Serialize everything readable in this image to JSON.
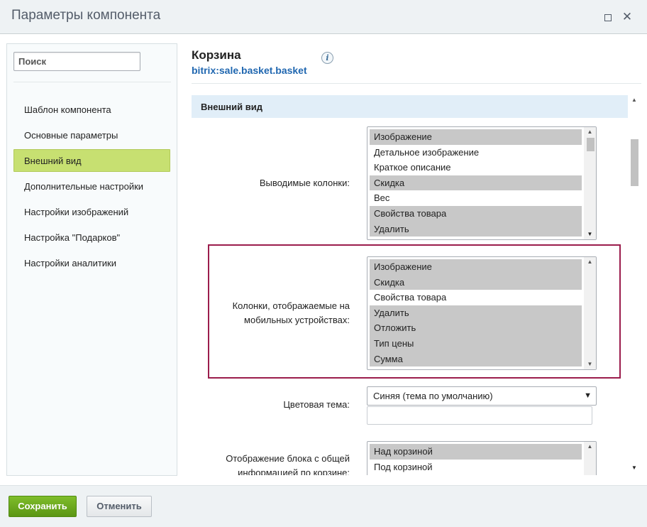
{
  "window": {
    "title": "Параметры компонента"
  },
  "sidebar": {
    "search_placeholder": "Поиск",
    "items": [
      {
        "label": "Шаблон компонента"
      },
      {
        "label": "Основные параметры"
      },
      {
        "label": "Внешний вид"
      },
      {
        "label": "Дополнительные настройки"
      },
      {
        "label": "Настройки изображений"
      },
      {
        "label": "Настройка \"Подарков\""
      },
      {
        "label": "Настройки аналитики"
      }
    ],
    "active_index": 2
  },
  "component": {
    "name": "Корзина",
    "code": "bitrix:sale.basket.basket"
  },
  "section": {
    "title": "Внешний вид"
  },
  "fields": {
    "columns": {
      "label": "Выводимые колонки:",
      "options": [
        {
          "text": "Изображение",
          "selected": true
        },
        {
          "text": "Детальное изображение",
          "selected": false
        },
        {
          "text": "Краткое описание",
          "selected": false
        },
        {
          "text": "Скидка",
          "selected": true
        },
        {
          "text": "Вес",
          "selected": false
        },
        {
          "text": "Свойства товара",
          "selected": true
        },
        {
          "text": "Удалить",
          "selected": true
        }
      ]
    },
    "mobile_columns": {
      "label": "Колонки, отображаемые на мобильных устройствах:",
      "options": [
        {
          "text": "Изображение",
          "selected": true
        },
        {
          "text": "Скидка",
          "selected": true
        },
        {
          "text": "Свойства товара",
          "selected": false
        },
        {
          "text": "Удалить",
          "selected": true
        },
        {
          "text": "Отложить",
          "selected": true
        },
        {
          "text": "Тип цены",
          "selected": true
        },
        {
          "text": "Сумма",
          "selected": true
        }
      ]
    },
    "color_theme": {
      "label": "Цветовая тема:",
      "value": "Синяя (тема по умолчанию)"
    },
    "total_block": {
      "label": "Отображение блока с общей информацией по корзине:",
      "options": [
        {
          "text": "Над корзиной",
          "selected": true
        },
        {
          "text": "Под корзиной",
          "selected": false
        }
      ]
    }
  },
  "footer": {
    "save_label": "Сохранить",
    "cancel_label": "Отменить"
  },
  "colors": {
    "active_nav": "#c7e071",
    "section_header": "#e1eef8",
    "highlight_border": "#9b1d4c",
    "save_button": "#6ba71e",
    "link": "#2067b0"
  }
}
